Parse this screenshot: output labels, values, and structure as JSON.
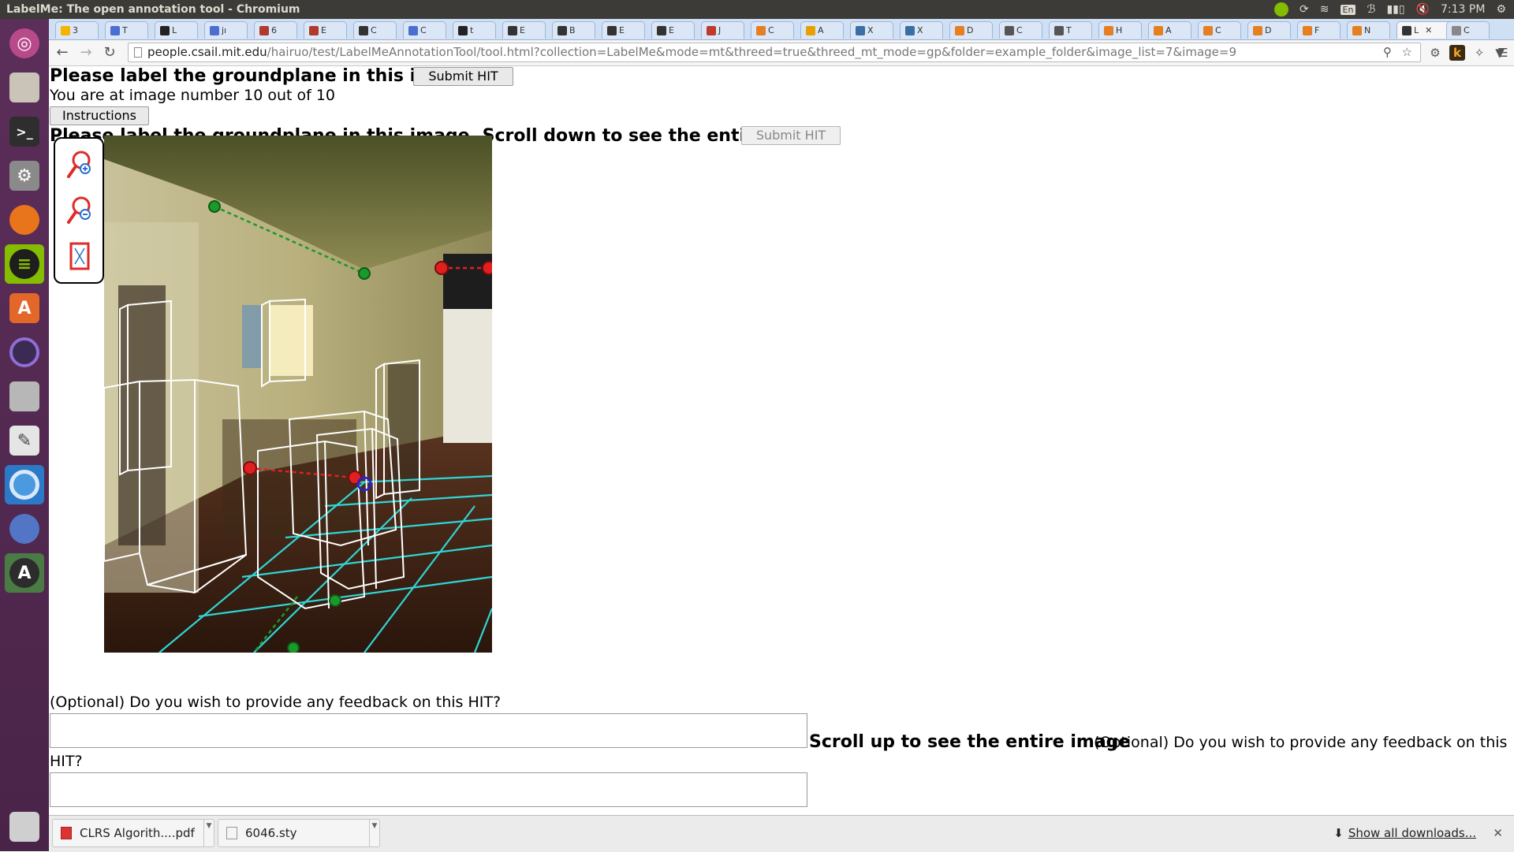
{
  "window": {
    "title": "LabelMe: The open annotation tool - Chromium",
    "clock": "7:13 PM",
    "keyboard": "En"
  },
  "tabs": [
    {
      "label": "3",
      "color": "#f4b400"
    },
    {
      "label": "T",
      "color": "#4a6fd0"
    },
    {
      "label": "L",
      "color": "#222222"
    },
    {
      "label": "jı",
      "color": "#4a6fd0"
    },
    {
      "label": "6",
      "color": "#b03a2e"
    },
    {
      "label": "E",
      "color": "#b03a2e"
    },
    {
      "label": "C",
      "color": "#333333"
    },
    {
      "label": "C",
      "color": "#4a6fd0"
    },
    {
      "label": "t",
      "color": "#222222"
    },
    {
      "label": "E",
      "color": "#333333"
    },
    {
      "label": "B",
      "color": "#333333"
    },
    {
      "label": "E",
      "color": "#333333"
    },
    {
      "label": "E",
      "color": "#333333"
    },
    {
      "label": "J",
      "color": "#c0392b"
    },
    {
      "label": "C",
      "color": "#e67e22"
    },
    {
      "label": "A",
      "color": "#e6a100"
    },
    {
      "label": "X",
      "color": "#3a6ea5"
    },
    {
      "label": "X",
      "color": "#3a6ea5"
    },
    {
      "label": "D",
      "color": "#e67e22"
    },
    {
      "label": "C",
      "color": "#555555"
    },
    {
      "label": "T",
      "color": "#555555"
    },
    {
      "label": "H",
      "color": "#e67e22"
    },
    {
      "label": "A",
      "color": "#e67e22"
    },
    {
      "label": "C",
      "color": "#e67e22"
    },
    {
      "label": "D",
      "color": "#e67e22"
    },
    {
      "label": "F",
      "color": "#e67e22"
    },
    {
      "label": "N",
      "color": "#e67e22"
    },
    {
      "label": "L",
      "color": "#333333",
      "active": true
    },
    {
      "label": "C",
      "color": "#888888"
    }
  ],
  "address": {
    "host": "people.csail.mit.edu",
    "path": "/hairuo/test/LabelMeAnnotationTool/tool.html?collection=LabelMe&mode=mt&threed=true&threed_mt_mode=gp&folder=example_folder&image_list=7&image=9"
  },
  "page": {
    "heading": "Please label the groundplane in this image.",
    "submit_label": "Submit HIT",
    "progress_text": "You are at image number 10 out of 10",
    "instructions_label": "Instructions",
    "heading_full": "Please label the groundplane in this image. Scroll down to see the entire image.",
    "submit_label_2": "Submit HIT",
    "feedback_prompt": "(Optional) Do you wish to provide any feedback on this HIT?",
    "scroll_up_text": "Scroll up to see the entire image",
    "feedback_prompt_2_part1": "(Optional) Do you wish to provide any feedback on this",
    "feedback_prompt_2_part2": "HIT?"
  },
  "tools": [
    {
      "name": "zoom-in-icon"
    },
    {
      "name": "zoom-out-icon"
    },
    {
      "name": "fit-to-screen-icon"
    }
  ],
  "downloads": {
    "items": [
      {
        "filename": "CLRS Algorith....pdf"
      },
      {
        "filename": "6046.sty"
      }
    ],
    "show_all": "Show all downloads..."
  },
  "colors": {
    "launcher": "#5c2e5a",
    "tabstrip": "#cfdff4",
    "groundplane_grid": "#2fd6d6",
    "vanishing_green": "#1a9a2a",
    "vanishing_red": "#e02020"
  }
}
